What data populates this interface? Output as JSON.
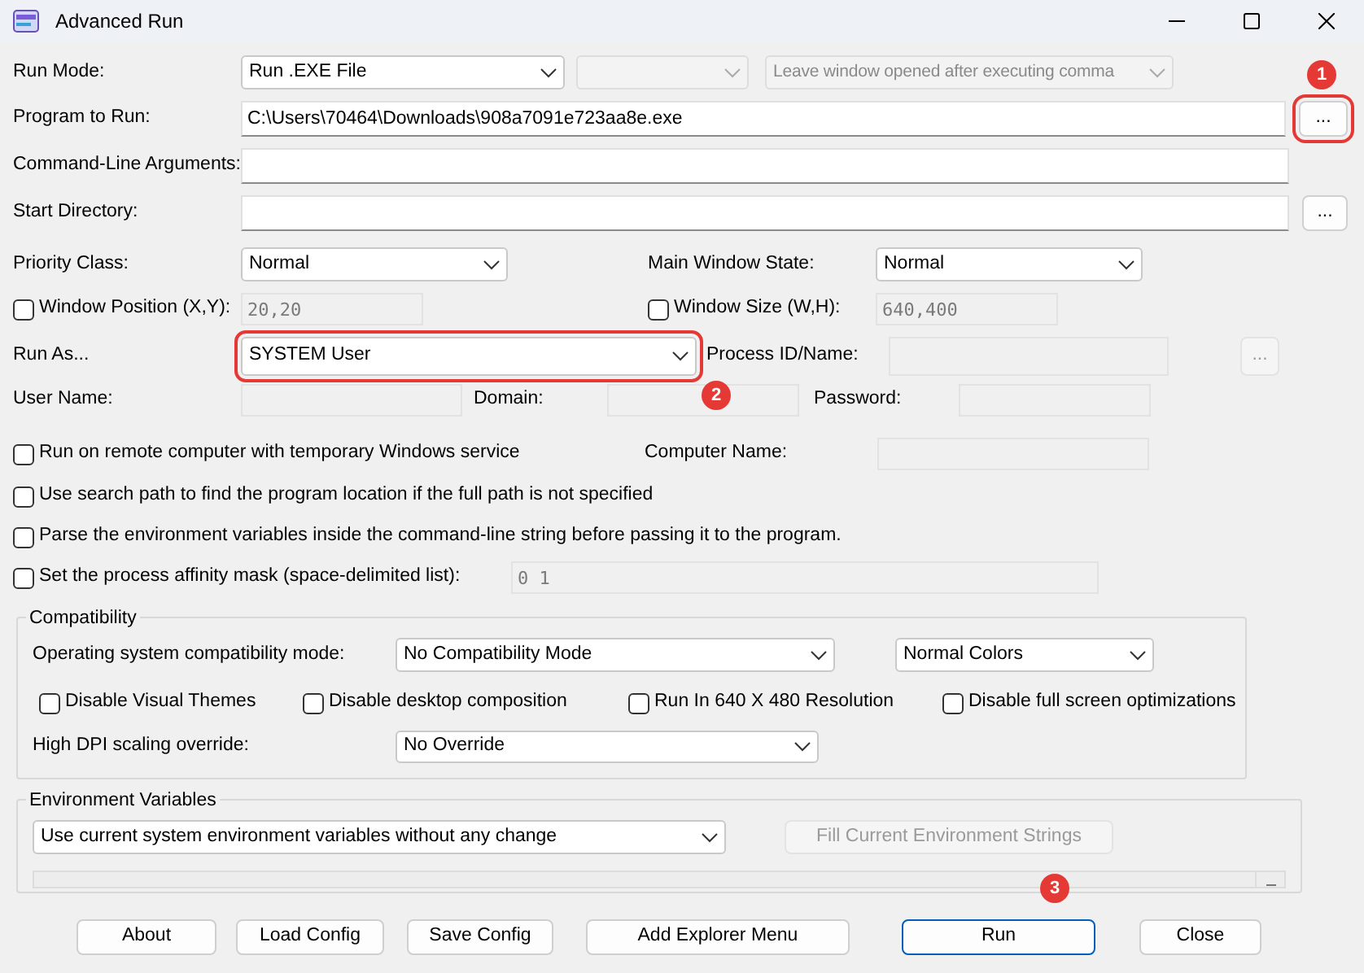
{
  "window": {
    "title": "Advanced Run"
  },
  "rows": [
    {
      "items": [
        {
          "kind": "label",
          "text": "Run Mode:"
        },
        {
          "kind": "select",
          "value": "Run .EXE File",
          "disabled": false
        },
        {
          "kind": "select",
          "value": "",
          "disabled": true
        },
        {
          "kind": "select",
          "value": "Leave window opened after executing comma",
          "disabled": true
        }
      ]
    },
    {
      "items": [
        {
          "kind": "label",
          "text": "Program to Run:"
        },
        {
          "kind": "input",
          "value": "C:\\Users\\70464\\Downloads\\908a7091e723aa8e.exe",
          "disabled": false
        },
        {
          "kind": "button",
          "label": "...",
          "disabled": false,
          "highlighted": true
        }
      ]
    },
    {
      "items": [
        {
          "kind": "label",
          "text": "Command-Line Arguments:"
        },
        {
          "kind": "input",
          "value": "",
          "disabled": false
        }
      ]
    },
    {
      "items": [
        {
          "kind": "label",
          "text": "Start Directory:"
        },
        {
          "kind": "input",
          "value": "",
          "disabled": false
        },
        {
          "kind": "button",
          "label": "...",
          "disabled": false,
          "highlighted": false
        }
      ]
    },
    {
      "items": [
        {
          "kind": "label",
          "text": "Priority Class:"
        },
        {
          "kind": "select",
          "value": "Normal",
          "disabled": false
        },
        {
          "kind": "label",
          "text": "Main Window State:"
        },
        {
          "kind": "select",
          "value": "Normal",
          "disabled": false
        }
      ]
    },
    {
      "items": [
        {
          "kind": "checkbox",
          "label": "Window Position (X,Y):",
          "checked": false
        },
        {
          "kind": "input",
          "value": "20,20",
          "disabled": true
        },
        {
          "kind": "checkbox",
          "label": "Window Size (W,H):",
          "checked": false
        },
        {
          "kind": "input",
          "value": "640,400",
          "disabled": true
        }
      ]
    },
    {
      "items": [
        {
          "kind": "label",
          "text": "Run As..."
        },
        {
          "kind": "select",
          "value": "SYSTEM User",
          "disabled": false,
          "highlighted": true
        },
        {
          "kind": "label",
          "text": "Process ID/Name:"
        },
        {
          "kind": "input",
          "value": "",
          "disabled": true
        },
        {
          "kind": "button",
          "label": "...",
          "disabled": true,
          "highlighted": false
        }
      ]
    },
    {
      "items": [
        {
          "kind": "label",
          "text": "User Name:"
        },
        {
          "kind": "input",
          "value": "",
          "disabled": true
        },
        {
          "kind": "label",
          "text": "Domain:"
        },
        {
          "kind": "input",
          "value": "",
          "disabled": true
        },
        {
          "kind": "label",
          "text": "Password:"
        },
        {
          "kind": "input",
          "value": "",
          "disabled": true
        }
      ]
    },
    {
      "items": [
        {
          "kind": "checkbox",
          "label": "Run on remote computer with temporary Windows service",
          "checked": false
        },
        {
          "kind": "label",
          "text": "Computer Name:"
        },
        {
          "kind": "input",
          "value": "",
          "disabled": true
        }
      ]
    },
    {
      "items": [
        {
          "kind": "checkbox",
          "label": "Use search path to find the program location if the full path is not specified",
          "checked": false
        }
      ]
    },
    {
      "items": [
        {
          "kind": "checkbox",
          "label": "Parse the environment variables inside the command-line string before passing it to the program.",
          "checked": false
        }
      ]
    },
    {
      "items": [
        {
          "kind": "checkbox",
          "label": "Set the process affinity mask (space-delimited list):",
          "checked": false
        },
        {
          "kind": "input",
          "value": "0 1",
          "disabled": true
        }
      ]
    }
  ],
  "groups": [
    {
      "title": "Compatibility",
      "rows": [
        {
          "items": [
            {
              "kind": "label",
              "text": "Operating system compatibility mode:"
            },
            {
              "kind": "select",
              "value": "No Compatibility Mode",
              "disabled": false
            },
            {
              "kind": "select",
              "value": "Normal Colors",
              "disabled": false
            }
          ]
        },
        {
          "items": [
            {
              "kind": "checkbox",
              "label": "Disable Visual Themes",
              "checked": false
            },
            {
              "kind": "checkbox",
              "label": "Disable desktop composition",
              "checked": false
            },
            {
              "kind": "checkbox",
              "label": "Run In 640 X 480 Resolution",
              "checked": false
            },
            {
              "kind": "checkbox",
              "label": "Disable full screen optimizations",
              "checked": false
            }
          ]
        },
        {
          "items": [
            {
              "kind": "label",
              "text": "High DPI scaling override:"
            },
            {
              "kind": "select",
              "value": "No Override",
              "disabled": false
            }
          ]
        }
      ]
    },
    {
      "title": "Environment Variables",
      "rows": [
        {
          "items": [
            {
              "kind": "select",
              "value": "Use current system environment variables without any change",
              "disabled": false
            },
            {
              "kind": "button",
              "label": "Fill Current Environment Strings",
              "disabled": true,
              "highlighted": false
            }
          ]
        },
        {
          "items": [
            {
              "kind": "textarea",
              "disabled": true
            }
          ]
        }
      ]
    }
  ],
  "buttons": [
    {
      "label": "About",
      "default": false
    },
    {
      "label": "Load Config",
      "default": false
    },
    {
      "label": "Save Config",
      "default": false
    },
    {
      "label": "Add Explorer Menu",
      "default": false
    },
    {
      "label": "Run",
      "default": true
    },
    {
      "label": "Close",
      "default": false
    }
  ],
  "callouts": [
    {
      "label": "1"
    },
    {
      "label": "2"
    },
    {
      "label": "3"
    }
  ]
}
